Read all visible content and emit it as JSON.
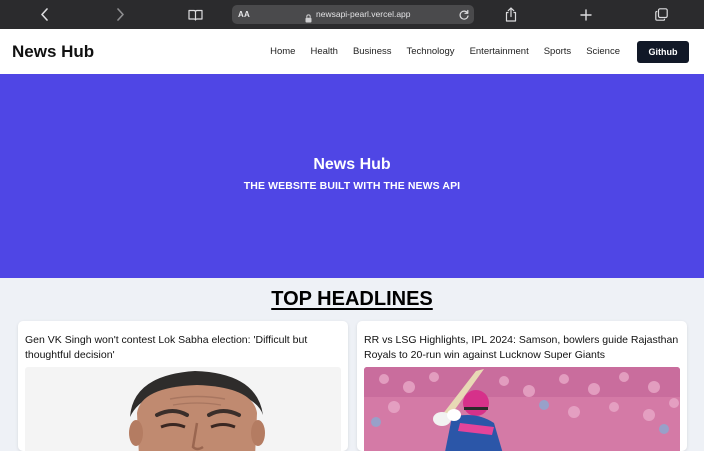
{
  "browser": {
    "text_size_label": "AA",
    "url": "newsapi-pearl.vercel.app"
  },
  "nav": {
    "brand": "News Hub",
    "links": [
      "Home",
      "Health",
      "Business",
      "Technology",
      "Entertainment",
      "Sports",
      "Science"
    ],
    "github_label": "Github"
  },
  "hero": {
    "title": "News Hub",
    "subtitle": "THE WEBSITE BUILT WITH THE NEWS API"
  },
  "headlines": {
    "section_title": "TOP HEADLINES",
    "articles": [
      {
        "title": "Gen VK Singh won't contest Lok Sabha election: 'Difficult but thoughtful decision'"
      },
      {
        "title": "RR vs LSG Highlights, IPL 2024: Samson, bowlers guide Rajasthan Royals to 20-run win against Lucknow Super Giants"
      }
    ]
  },
  "colors": {
    "hero_bg": "#4f46e5",
    "page_bg": "#eef1f6",
    "toolbar_bg": "#2b2b2d",
    "button_bg": "#111827"
  }
}
